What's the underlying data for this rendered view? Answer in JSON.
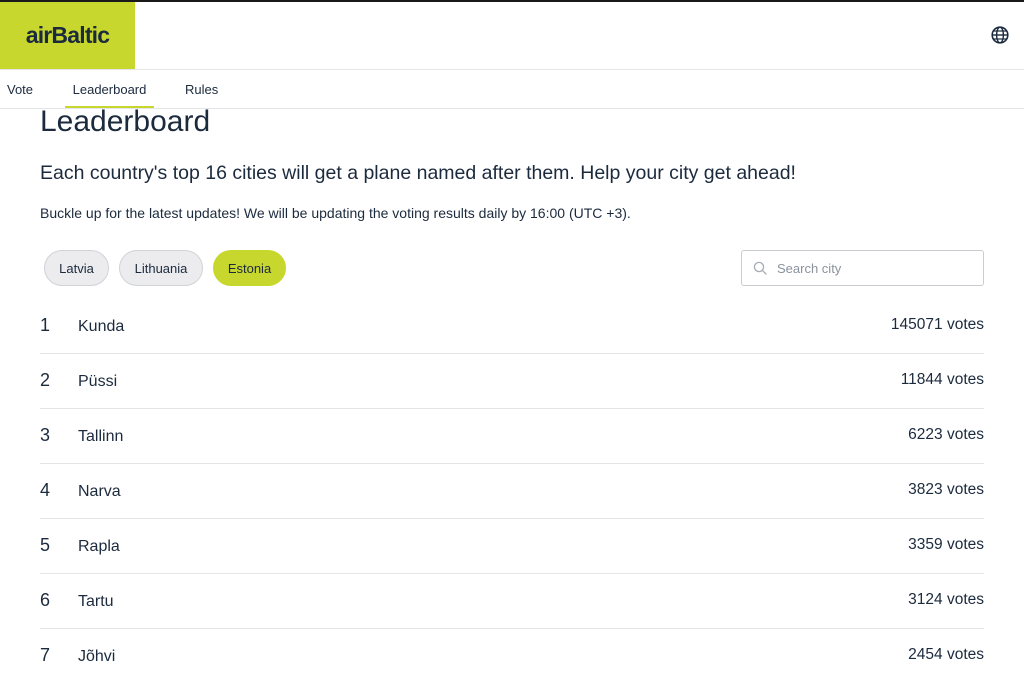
{
  "brand": {
    "logo_text": "airBaltic",
    "accent_color": "#c8d72e",
    "text_color": "#1b2a3d"
  },
  "header": {
    "language_icon": "globe-icon"
  },
  "nav": {
    "items": [
      {
        "label": "Vote"
      },
      {
        "label": "Leaderboard",
        "active": true
      },
      {
        "label": "Rules"
      }
    ]
  },
  "page": {
    "title": "Leaderboard",
    "subtitle": "Each country's top 16 cities will get a plane named after them. Help your city get ahead!",
    "notice": "Buckle up for the latest updates! We will be updating the voting results daily by 16:00 (UTC +3)."
  },
  "countries": [
    {
      "label": "Latvia",
      "active": false
    },
    {
      "label": "Lithuania",
      "active": false
    },
    {
      "label": "Estonia",
      "active": true
    }
  ],
  "search": {
    "placeholder": "Search city",
    "value": "",
    "icon": "search-icon"
  },
  "leaderboard": [
    {
      "rank": "1",
      "city": "Kunda",
      "votes": "145071 votes"
    },
    {
      "rank": "2",
      "city": "Püssi",
      "votes": "11844 votes"
    },
    {
      "rank": "3",
      "city": "Tallinn",
      "votes": "6223 votes"
    },
    {
      "rank": "4",
      "city": "Narva",
      "votes": "3823 votes"
    },
    {
      "rank": "5",
      "city": "Rapla",
      "votes": "3359 votes"
    },
    {
      "rank": "6",
      "city": "Tartu",
      "votes": "3124 votes"
    },
    {
      "rank": "7",
      "city": "Jõhvi",
      "votes": "2454 votes"
    }
  ]
}
